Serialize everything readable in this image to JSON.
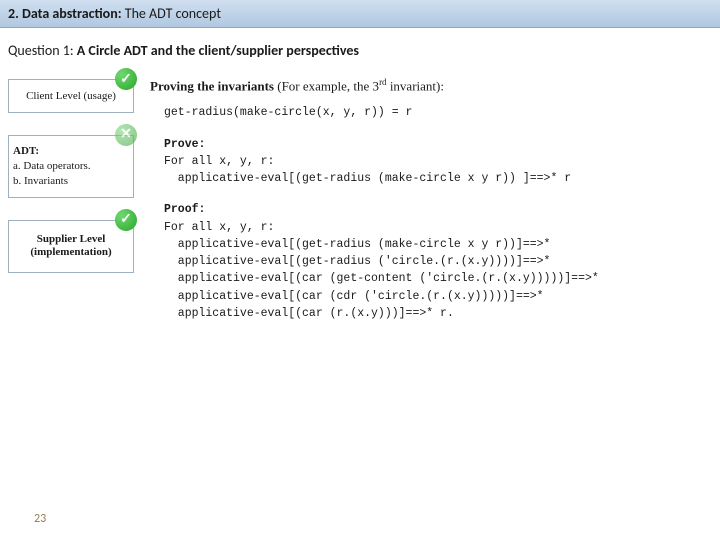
{
  "title_bar": {
    "number": "2. ",
    "bold_title": "Data abstraction:",
    "subtitle": " The ADT concept"
  },
  "question": {
    "prefix": "Question 1:  ",
    "bold": "A Circle ADT and the client/supplier perspectives"
  },
  "left": {
    "client": "Client Level (usage)",
    "adt_title": "ADT:",
    "adt_a": "  a. Data operators.",
    "adt_b": "  b. Invariants",
    "supplier_line1": "Supplier Level",
    "supplier_line2": "(implementation)"
  },
  "icons": {
    "check": "✓",
    "cross": "✕"
  },
  "right": {
    "proving_bold": "Proving the invariants",
    "proving_rest_1": " (For example, the 3",
    "proving_sup": "rd",
    "proving_rest_2": " invariant):",
    "code1": "get-radius(make-circle(x, y, r)) = r",
    "prove_label": "Prove:",
    "prove_body": "For all x, y, r:\n  applicative-eval[(get-radius (make-circle x y r)) ]==>* r",
    "proof_label": "Proof:",
    "proof_body": "For all x, y, r:\n  applicative-eval[(get-radius (make-circle x y r))]==>*\n  applicative-eval[(get-radius ('circle.(r.(x.y))))]==>*\n  applicative-eval[(car (get-content ('circle.(r.(x.y)))))]==>*\n  applicative-eval[(car (cdr ('circle.(r.(x.y)))))]==>*\n  applicative-eval[(car (r.(x.y)))]==>* r."
  },
  "page": "23"
}
